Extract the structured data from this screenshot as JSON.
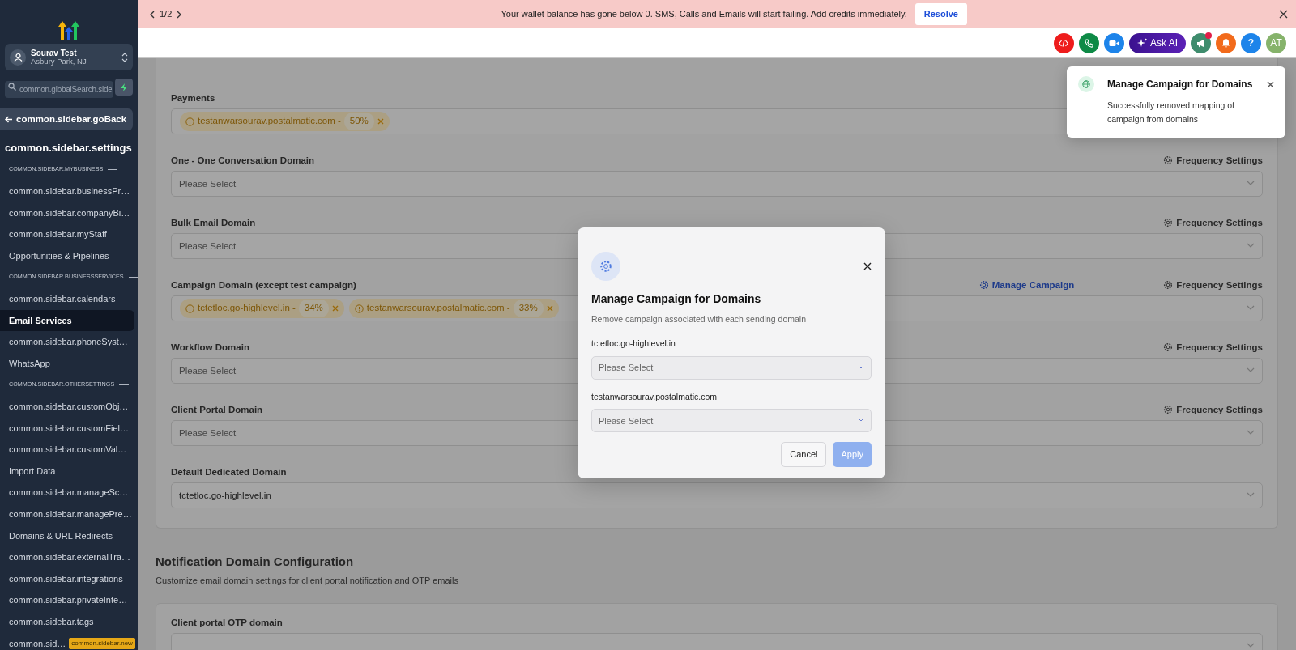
{
  "banner": {
    "pager": "1/2",
    "message": "Your wallet balance has gone below 0. SMS, Calls and Emails will start failing. Add credits immediately.",
    "action": "Resolve"
  },
  "header": {
    "ask_ai": "Ask AI",
    "help": "?",
    "avatar": "AT",
    "notification_dot": true
  },
  "sidebar": {
    "location": {
      "name": "Sourav Test",
      "address": "Asbury Park, NJ"
    },
    "search": {
      "placeholder": "common.globalSearch.side"
    },
    "back": "common.sidebar.goBack",
    "title": "common.sidebar.settings",
    "items": [
      {
        "kind": "section",
        "label": "COMMON.SIDEBAR.MYBUSINESS"
      },
      {
        "kind": "link",
        "label": "common.sidebar.businessPr…",
        "selected": false
      },
      {
        "kind": "link",
        "label": "common.sidebar.companyBi…",
        "selected": false
      },
      {
        "kind": "link",
        "label": "common.sidebar.myStaff",
        "selected": false
      },
      {
        "kind": "link",
        "label": "Opportunities & Pipelines",
        "selected": false
      },
      {
        "kind": "section",
        "label": "COMMON.SIDEBAR.BUSINESSSERVICES"
      },
      {
        "kind": "link",
        "label": "common.sidebar.calendars",
        "selected": false
      },
      {
        "kind": "link",
        "label": "Email Services",
        "selected": true
      },
      {
        "kind": "link",
        "label": "common.sidebar.phoneSyst…",
        "selected": false
      },
      {
        "kind": "link",
        "label": "WhatsApp",
        "selected": false
      },
      {
        "kind": "section",
        "label": "COMMON.SIDEBAR.OTHERSETTINGS"
      },
      {
        "kind": "link",
        "label": "common.sidebar.customObj…",
        "selected": false
      },
      {
        "kind": "link",
        "label": "common.sidebar.customFiel…",
        "selected": false
      },
      {
        "kind": "link",
        "label": "common.sidebar.customVal…",
        "selected": false
      },
      {
        "kind": "link",
        "label": "Import Data",
        "selected": false
      },
      {
        "kind": "link",
        "label": "common.sidebar.manageSc…",
        "selected": false
      },
      {
        "kind": "link",
        "label": "common.sidebar.managePre…",
        "selected": false
      },
      {
        "kind": "link",
        "label": "Domains & URL Redirects",
        "selected": false
      },
      {
        "kind": "link",
        "label": "common.sidebar.externalTra…",
        "selected": false
      },
      {
        "kind": "link",
        "label": "common.sidebar.integrations",
        "selected": false
      },
      {
        "kind": "link",
        "label": "common.sidebar.privateInte…",
        "selected": false
      },
      {
        "kind": "link",
        "label": "common.sidebar.tags",
        "selected": false
      },
      {
        "kind": "link",
        "label": "common.sid…",
        "badge": "common.sidebar.new",
        "selected": false
      }
    ]
  },
  "fields": [
    {
      "label": "Payments",
      "chips": [
        {
          "domain": "testanwarsourav.postalmatic.com -",
          "percent": "50%"
        }
      ]
    },
    {
      "label": "One - One Conversation Domain",
      "placeholder": "Please Select",
      "frequency_link": "Frequency Settings"
    },
    {
      "label": "Bulk Email Domain",
      "placeholder": "Please Select",
      "frequency_link": "Frequency Settings"
    },
    {
      "label": "Campaign Domain (except test campaign)",
      "chips": [
        {
          "domain": "tctetloc.go-highlevel.in -",
          "percent": "34%"
        },
        {
          "domain": "testanwarsourav.postalmatic.com -",
          "percent": "33%"
        }
      ],
      "manage_link": "Manage Campaign",
      "frequency_link": "Frequency Settings"
    },
    {
      "label": "Workflow Domain",
      "placeholder": "Please Select",
      "frequency_link": "Frequency Settings"
    },
    {
      "label": "Client Portal Domain",
      "placeholder": "Please Select",
      "frequency_link": "Frequency Settings"
    },
    {
      "label": "Default Dedicated Domain",
      "value": "tctetloc.go-highlevel.in"
    }
  ],
  "notification": {
    "title": "Notification Domain Configuration",
    "subtitle": "Customize email domain settings for client portal notification and OTP emails",
    "fields": [
      {
        "label": "Client portal OTP domain"
      }
    ]
  },
  "modal": {
    "title": "Manage Campaign for Domains",
    "subtitle": "Remove campaign associated with each sending domain",
    "domains": [
      {
        "label": "tctetloc.go-highlevel.in",
        "placeholder": "Please Select"
      },
      {
        "label": "testanwarsourav.postalmatic.com",
        "placeholder": "Please Select"
      }
    ],
    "cancel": "Cancel",
    "apply": {
      "label": "Apply",
      "disabled": true
    }
  },
  "toast": {
    "title": "Manage Campaign for Domains",
    "message": "Successfully removed mapping of campaign from domains"
  }
}
